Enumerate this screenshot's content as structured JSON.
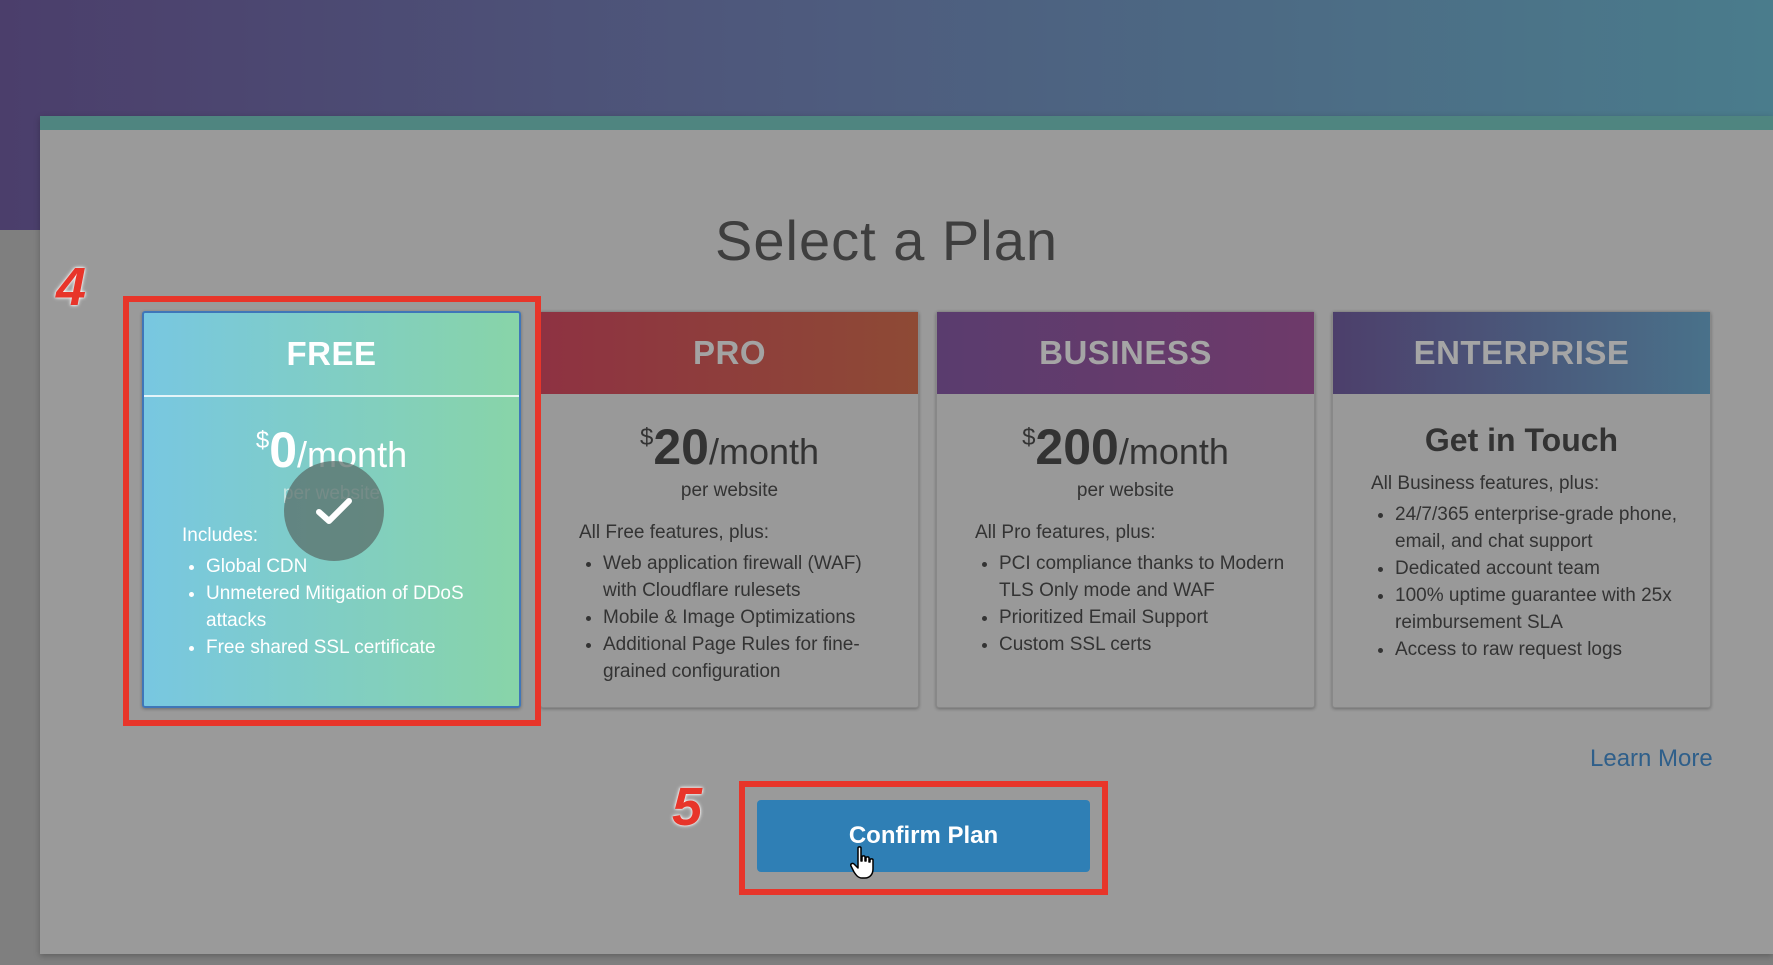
{
  "title": "Select a Plan",
  "plans": [
    {
      "name": "FREE",
      "currency": "$",
      "amount": "0",
      "period": "/month",
      "sub": "per website",
      "intro": "Includes:",
      "features": [
        "Global CDN",
        "Unmetered Mitigation of DDoS attacks",
        "Free shared SSL certificate"
      ],
      "selected": true
    },
    {
      "name": "PRO",
      "currency": "$",
      "amount": "20",
      "period": "/month",
      "sub": "per website",
      "intro": "All Free features, plus:",
      "features": [
        "Web application firewall (WAF) with Cloudflare rulesets",
        "Mobile & Image Optimizations",
        "Additional Page Rules for fine-grained configuration"
      ]
    },
    {
      "name": "BUSINESS",
      "currency": "$",
      "amount": "200",
      "period": "/month",
      "sub": "per website",
      "intro": "All Pro features, plus:",
      "features": [
        "PCI compliance thanks to Modern TLS Only mode and WAF",
        "Prioritized Email Support",
        "Custom SSL certs"
      ]
    },
    {
      "name": "ENTERPRISE",
      "heading": "Get in Touch",
      "intro": "All Business features, plus:",
      "features": [
        "24/7/365 enterprise-grade phone, email, and chat support",
        "Dedicated account team",
        "100% uptime guarantee with 25x reimbursement SLA",
        "Access to raw request logs"
      ]
    }
  ],
  "learn_more": "Learn More",
  "confirm_label": "Confirm Plan",
  "annotations": {
    "step_4": "4",
    "step_5": "5"
  },
  "icons": {
    "selected": "check-icon",
    "pointer": "hand-pointer-icon"
  },
  "colors": {
    "highlight": "#e8352a",
    "button": "#2f7fb5",
    "link": "#2f5f8a"
  }
}
